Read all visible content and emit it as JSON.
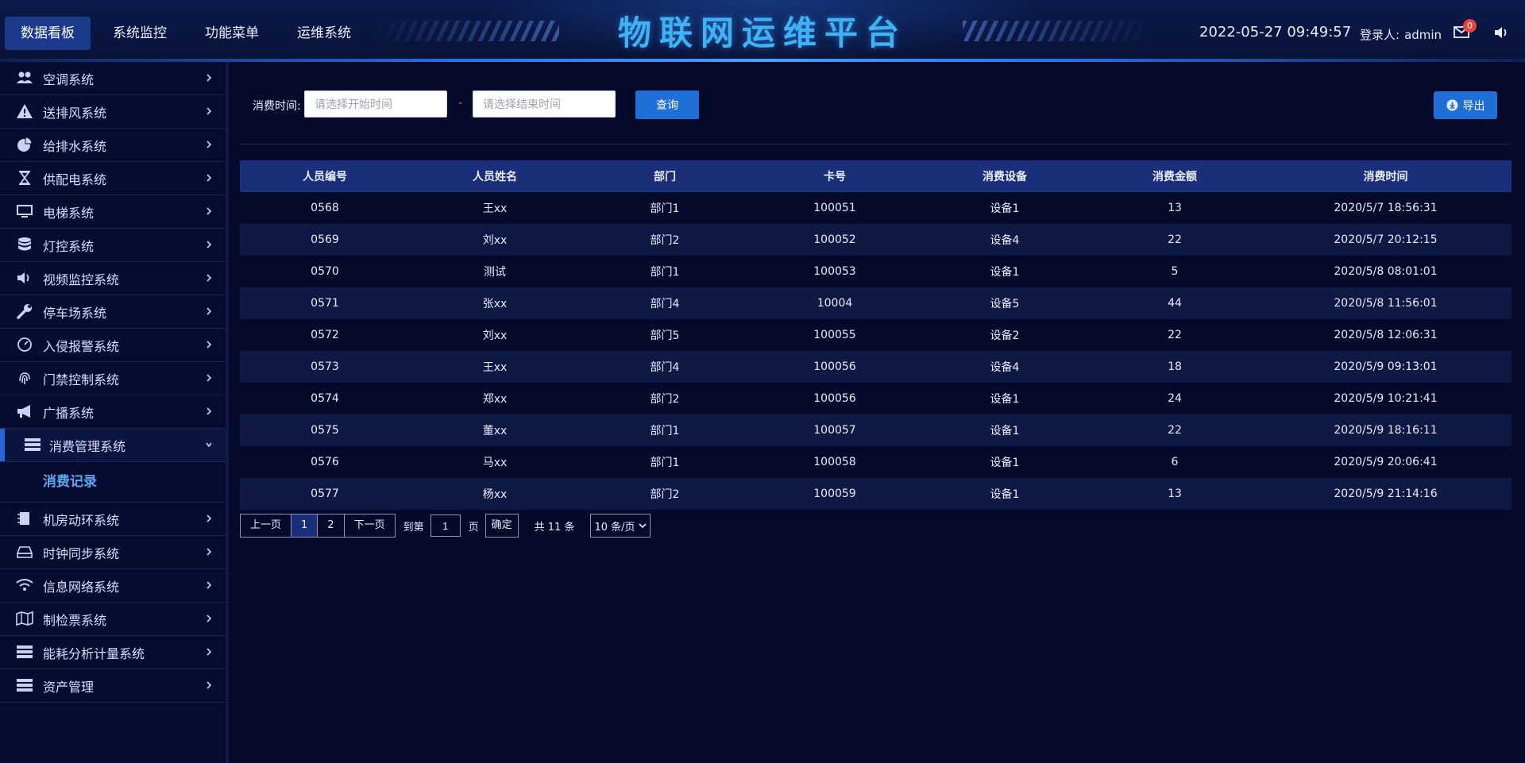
{
  "header": {
    "nav": [
      "数据看板",
      "系统监控",
      "功能菜单",
      "运维系统"
    ],
    "active_nav": "数据看板",
    "title": "物联网运维平台",
    "datetime": "2022-05-27 09:49:57",
    "login_label": "登录人:",
    "username": "admin",
    "mail_badge": "0",
    "icons": [
      "mail-icon",
      "sound-icon"
    ]
  },
  "sidebar": {
    "items": [
      {
        "label": "空调系统",
        "icon": "users-icon"
      },
      {
        "label": "送排风系统",
        "icon": "warning-icon"
      },
      {
        "label": "给排水系统",
        "icon": "pie-icon"
      },
      {
        "label": "供配电系统",
        "icon": "hourglass-icon"
      },
      {
        "label": "电梯系统",
        "icon": "monitor-icon"
      },
      {
        "label": "灯控系统",
        "icon": "database-icon"
      },
      {
        "label": "视频监控系统",
        "icon": "volume-icon"
      },
      {
        "label": "停车场系统",
        "icon": "wrench-icon"
      },
      {
        "label": "入侵报警系统",
        "icon": "dashboard-icon"
      },
      {
        "label": "门禁控制系统",
        "icon": "fingerprint-icon"
      },
      {
        "label": "广播系统",
        "icon": "bullhorn-icon"
      },
      {
        "label": "消费管理系统",
        "icon": "server-icon"
      }
    ],
    "open_item": "消费管理系统",
    "sub_item": "消费记录",
    "items_after": [
      {
        "label": "机房动环系统",
        "icon": "chip-icon"
      },
      {
        "label": "时钟同步系统",
        "icon": "drive-icon"
      },
      {
        "label": "信息网络系统",
        "icon": "wifi-icon"
      },
      {
        "label": "制检票系统",
        "icon": "map-icon"
      },
      {
        "label": "能耗分析计量系统",
        "icon": "server-icon"
      },
      {
        "label": "资产管理",
        "icon": "server-icon"
      }
    ]
  },
  "filter": {
    "label": "消费时间:",
    "start_placeholder": "请选择开始时间",
    "end_placeholder": "请选择结束时间",
    "separator": "-",
    "query_label": "查询",
    "export_label": "导出"
  },
  "table": {
    "columns": [
      "人员编号",
      "人员姓名",
      "部门",
      "卡号",
      "消费设备",
      "消费金额",
      "消费时间"
    ],
    "rows": [
      [
        "0568",
        "王xx",
        "部门1",
        "100051",
        "设备1",
        "13",
        "2020/5/7 18:56:31"
      ],
      [
        "0569",
        "刘xx",
        "部门2",
        "100052",
        "设备4",
        "22",
        "2020/5/7 20:12:15"
      ],
      [
        "0570",
        "测试",
        "部门1",
        "100053",
        "设备1",
        "5",
        "2020/5/8 08:01:01"
      ],
      [
        "0571",
        "张xx",
        "部门4",
        "10004",
        "设备5",
        "44",
        "2020/5/8 11:56:01"
      ],
      [
        "0572",
        "刘xx",
        "部门5",
        "100055",
        "设备2",
        "22",
        "2020/5/8 12:06:31"
      ],
      [
        "0573",
        "王xx",
        "部门4",
        "100056",
        "设备4",
        "18",
        "2020/5/9 09:13:01"
      ],
      [
        "0574",
        "郑xx",
        "部门2",
        "100056",
        "设备1",
        "24",
        "2020/5/9 10:21:41"
      ],
      [
        "0575",
        "董xx",
        "部门1",
        "100057",
        "设备1",
        "22",
        "2020/5/9 18:16:11"
      ],
      [
        "0576",
        "马xx",
        "部门1",
        "100058",
        "设备1",
        "6",
        "2020/5/9 20:06:41"
      ],
      [
        "0577",
        "杨xx",
        "部门2",
        "100059",
        "设备1",
        "13",
        "2020/5/9 21:14:16"
      ]
    ]
  },
  "pagination": {
    "prev": "上一页",
    "pages": [
      "1",
      "2"
    ],
    "current": "1",
    "next": "下一页",
    "goto_label": "到第",
    "goto_value": "1",
    "page_unit": "页",
    "confirm": "确定",
    "total": "共 11 条",
    "page_size": "10 条/页"
  },
  "colors": {
    "background": "#050a2a",
    "accent": "#1f6fd6",
    "title": "#3fb2f5",
    "table_header": "#1a2e7a",
    "badge": "#e8423b"
  }
}
